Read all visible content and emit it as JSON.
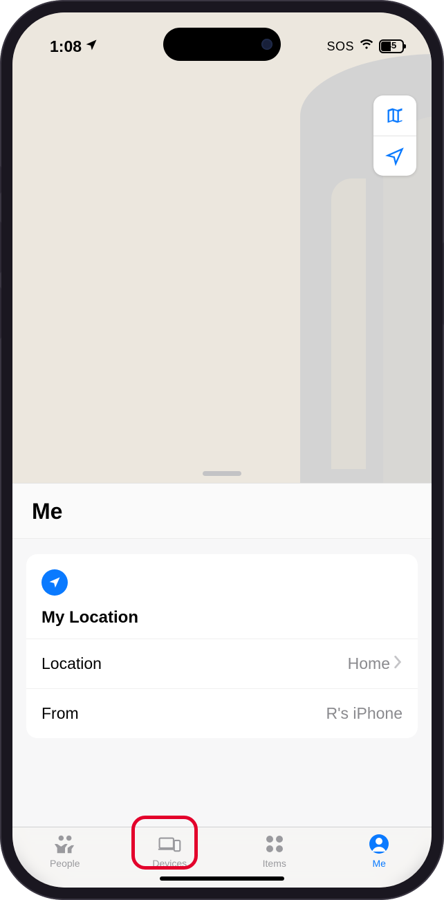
{
  "status": {
    "time": "1:08",
    "sos": "SOS",
    "battery_percent": "45"
  },
  "sheet": {
    "title": "Me",
    "my_location_header": "My Location",
    "rows": {
      "location_label": "Location",
      "location_value": "Home",
      "from_label": "From",
      "from_value": "R's iPhone"
    }
  },
  "tabs": {
    "people": "People",
    "devices": "Devices",
    "items": "Items",
    "me": "Me"
  }
}
